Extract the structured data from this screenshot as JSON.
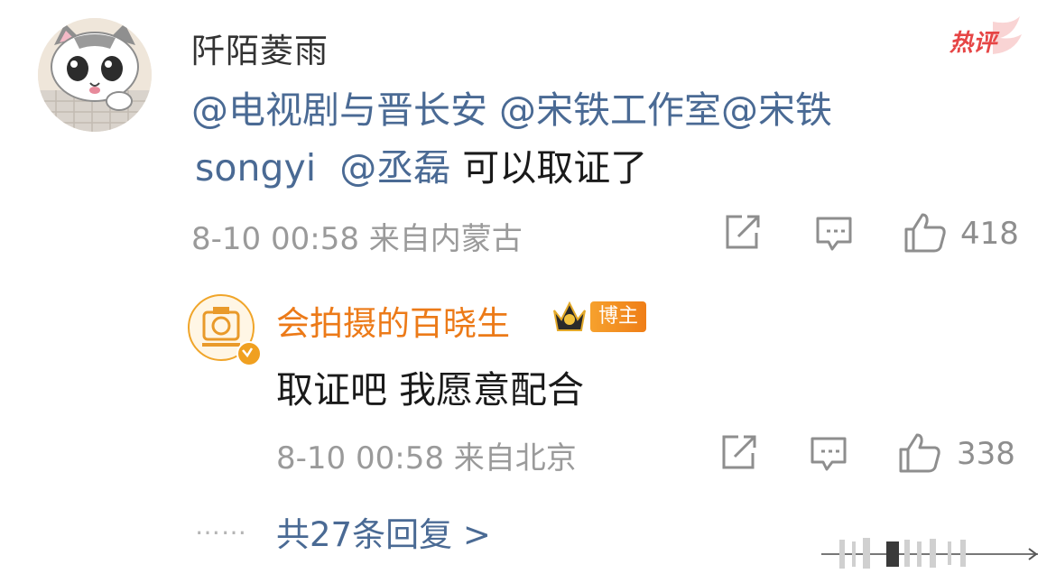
{
  "comment": {
    "username": "阡陌菱雨",
    "badge": "热评",
    "mentions_line1": [
      "@电视剧与晋长安",
      "@宋铁工作室",
      "@宋铁"
    ],
    "mention_line2": "songyi",
    "mention_line2b": "@丞磊",
    "text": "可以取证了",
    "timestamp": "8-10 00:58",
    "source": "来自内蒙古",
    "likes": "418"
  },
  "reply": {
    "username": "会拍摄的百晓生",
    "badge": "博主",
    "text": "取证吧 我愿意配合",
    "timestamp": "8-10 00:58",
    "source": "来自北京",
    "likes": "338"
  },
  "more": {
    "dots": "……",
    "label": "共27条回复 >"
  },
  "colors": {
    "mention": "#4a6a94",
    "reply_name": "#ec7a18",
    "hot": "#e64545",
    "meta": "#9a9a9a"
  },
  "icons": [
    "share-icon",
    "comment-icon",
    "like-icon",
    "crown-icon",
    "verified-icon",
    "hot-comment-icon"
  ]
}
